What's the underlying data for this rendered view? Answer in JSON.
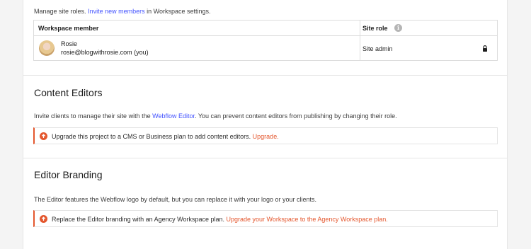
{
  "members": {
    "intro_text": "Manage site roles.",
    "intro_link": "Invite new members",
    "intro_suffix": "in Workspace settings.",
    "column_member": "Workspace member",
    "column_role": "Site role",
    "rows": [
      {
        "name": "Rosie",
        "email": "rosie@blogwithrosie.com (you)",
        "role": "Site admin"
      }
    ]
  },
  "content_editors": {
    "title": "Content Editors",
    "desc_prefix": "Invite clients to manage their site with the",
    "desc_link": "Webflow Editor",
    "desc_suffix": ". You can prevent content editors from publishing by changing their role.",
    "notice_text": "Upgrade this project to a CMS or Business plan to add content editors.",
    "notice_link": "Upgrade."
  },
  "editor_branding": {
    "title": "Editor Branding",
    "desc": "The Editor features the Webflow logo by default, but you can replace it with your logo or your clients.",
    "notice_text": "Replace the Editor branding with an Agency Workspace plan.",
    "notice_link": "Upgrade your Workspace to the Agency Workspace plan."
  },
  "icons": {
    "info": "info-icon",
    "lock": "lock-icon",
    "upgrade": "arrow-up-circle-icon"
  },
  "colors": {
    "accent_blue": "#4353ff",
    "accent_orange": "#e4572e"
  }
}
